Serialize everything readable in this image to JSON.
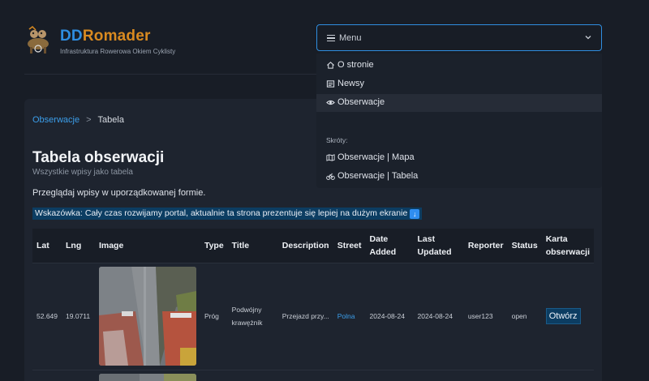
{
  "header": {
    "brand_part1": "DD",
    "brand_part2": "Romader",
    "tagline": "Infrastruktura Rowerowa Okiem Cyklisty",
    "logo_icon": "camel-mascot-logo"
  },
  "menu": {
    "button_label": "Menu",
    "items": [
      {
        "label": "O stronie",
        "icon": "home-icon"
      },
      {
        "label": "Newsy",
        "icon": "newspaper-icon"
      },
      {
        "label": "Obserwacje",
        "icon": "eye-icon"
      }
    ],
    "shortcuts_heading": "Skróty:",
    "shortcuts": [
      {
        "label": "Obserwacje | Mapa",
        "icon": "map-icon"
      },
      {
        "label": "Obserwacje | Tabela",
        "icon": "bike-icon"
      }
    ]
  },
  "breadcrumb": {
    "parent": "Obserwacje",
    "separator": ">",
    "current": "Tabela"
  },
  "page": {
    "title": "Tabela obserwacji",
    "subtitle": "Wszystkie wpisy jako tabela",
    "intro": "Przeglądaj wpisy w uporządkowanej formie.",
    "hint": "Wskazówka: Cały czas rozwijamy portal, aktualnie ta strona prezentuje się lepiej na dużym ekranie",
    "hint_icon": "down-arrow-icon"
  },
  "table": {
    "headers": [
      "Lat",
      "Lng",
      "Image",
      "Type",
      "Title",
      "Description",
      "Street",
      "Date Added",
      "Last Updated",
      "Reporter",
      "Status",
      "Karta obserwacji"
    ],
    "rows": [
      {
        "lat": "52.649",
        "lng": "19.0711",
        "type": "Próg",
        "title": "Podwójny krawężnik",
        "description": "Przejazd przy...",
        "street": "Polna",
        "date_added": "2024-08-24",
        "last_updated": "2024-08-24",
        "reporter": "user123",
        "status": "open",
        "action": "Otwórz"
      }
    ]
  },
  "colors": {
    "background": "#181d26",
    "card": "#1e242f",
    "accent_blue": "#2e8de0",
    "brand_orange": "#d98a20",
    "hint_bg": "#0c3d62"
  }
}
